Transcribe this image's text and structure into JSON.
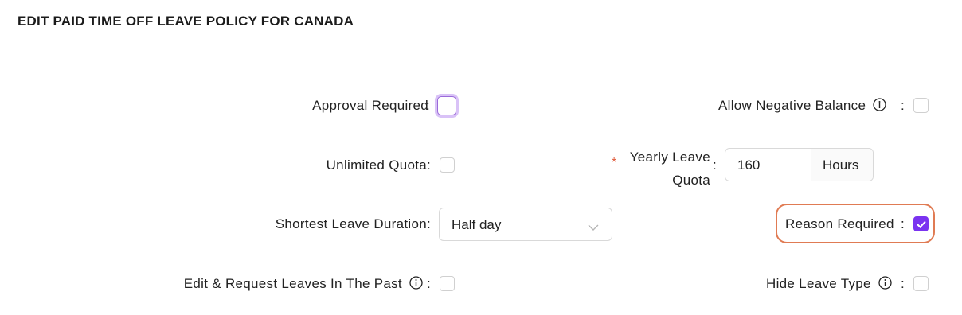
{
  "header": {
    "title": "EDIT PAID TIME OFF LEAVE POLICY FOR CANADA"
  },
  "fields": {
    "approval_required": {
      "label": "Approval Required",
      "checked": false
    },
    "allow_negative_balance": {
      "label": "Allow Negative Balance",
      "checked": false
    },
    "unlimited_quota": {
      "label": "Unlimited Quota",
      "checked": false
    },
    "yearly_leave_quota": {
      "label_line1": "Yearly Leave",
      "label_line2": "Quota",
      "required_mark": "*",
      "value": "160",
      "unit": "Hours"
    },
    "shortest_leave_duration": {
      "label": "Shortest Leave Duration",
      "value": "Half day"
    },
    "reason_required": {
      "label": "Reason Required",
      "checked": true
    },
    "edit_request_past": {
      "label": "Edit & Request Leaves In The Past",
      "checked": false
    },
    "hide_leave_type": {
      "label": "Hide Leave Type",
      "checked": false
    }
  },
  "separator": ":",
  "colors": {
    "accent": "#7a33f0",
    "highlight": "#e07b53",
    "required": "#e05a3a"
  },
  "icons": [
    "info-icon",
    "checkmark-icon",
    "chevron-down-icon"
  ]
}
